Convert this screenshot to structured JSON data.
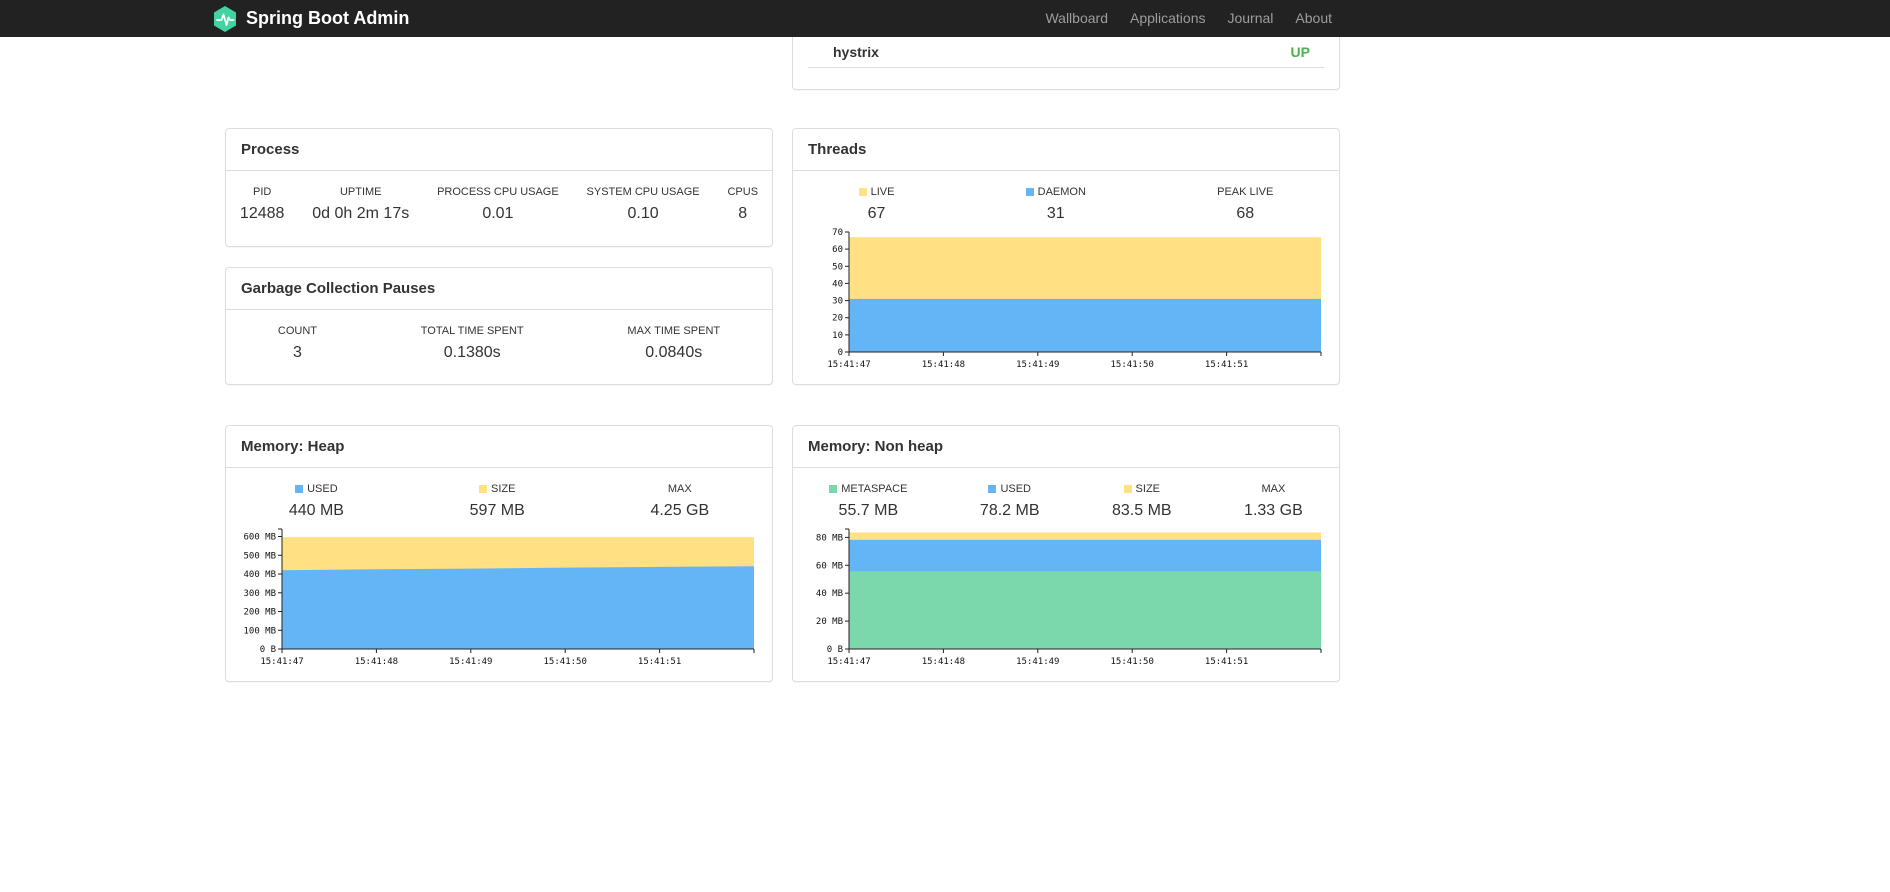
{
  "colors": {
    "brand_logo": "#42d3a2",
    "status_up": "#4caf50"
  },
  "navbar": {
    "brand": "Spring Boot Admin",
    "items": [
      "Wallboard",
      "Applications",
      "Journal",
      "About"
    ]
  },
  "application_panel": {
    "rows": [
      {
        "name": "hystrix",
        "status": "UP"
      }
    ]
  },
  "panels": {
    "process": {
      "title": "Process",
      "metrics": [
        {
          "label": "PID",
          "value": "12488"
        },
        {
          "label": "UPTIME",
          "value": "0d 0h 2m 17s"
        },
        {
          "label": "PROCESS CPU USAGE",
          "value": "0.01"
        },
        {
          "label": "SYSTEM CPU USAGE",
          "value": "0.10"
        },
        {
          "label": "CPUS",
          "value": "8"
        }
      ]
    },
    "gc": {
      "title": "Garbage Collection Pauses",
      "metrics": [
        {
          "label": "COUNT",
          "value": "3"
        },
        {
          "label": "TOTAL TIME SPENT",
          "value": "0.1380s"
        },
        {
          "label": "MAX TIME SPENT",
          "value": "0.0840s"
        }
      ]
    },
    "threads": {
      "title": "Threads",
      "metrics": [
        {
          "label": "LIVE",
          "value": "67",
          "swatch": "#ffe082"
        },
        {
          "label": "DAEMON",
          "value": "31",
          "swatch": "#64b5f6"
        },
        {
          "label": "PEAK LIVE",
          "value": "68"
        }
      ],
      "chart_data": {
        "type": "area",
        "title": "Threads",
        "x_labels": [
          "15:41:47",
          "15:41:48",
          "15:41:49",
          "15:41:50",
          "15:41:51"
        ],
        "ylim": [
          0,
          70
        ],
        "y_tick_values": [
          0,
          10,
          20,
          30,
          40,
          50,
          60,
          70
        ],
        "y_tick_labels": [
          "0",
          "10",
          "20",
          "30",
          "40",
          "50",
          "60",
          "70"
        ],
        "grid": false,
        "series": [
          {
            "name": "LIVE",
            "color": "#ffe082",
            "values": [
              67,
              67,
              67,
              67,
              67,
              67
            ]
          },
          {
            "name": "DAEMON",
            "color": "#64b5f6",
            "values": [
              31,
              31,
              31,
              31,
              31,
              31
            ]
          }
        ]
      }
    },
    "heap": {
      "title": "Memory: Heap",
      "metrics": [
        {
          "label": "USED",
          "value": "440 MB",
          "swatch": "#64b5f6"
        },
        {
          "label": "SIZE",
          "value": "597 MB",
          "swatch": "#ffe082"
        },
        {
          "label": "MAX",
          "value": "4.25 GB"
        }
      ],
      "chart_data": {
        "type": "area",
        "title": "Memory: Heap",
        "x_labels": [
          "15:41:47",
          "15:41:48",
          "15:41:49",
          "15:41:50",
          "15:41:51"
        ],
        "ylim": [
          0,
          640
        ],
        "y_tick_values": [
          0,
          100,
          200,
          300,
          400,
          500,
          600
        ],
        "y_tick_labels": [
          "0 B",
          "100 MB",
          "200 MB",
          "300 MB",
          "400 MB",
          "500 MB",
          "600 MB"
        ],
        "grid": false,
        "series": [
          {
            "name": "SIZE",
            "color": "#ffe082",
            "values": [
              597,
              597,
              597,
              597,
              597,
              597
            ]
          },
          {
            "name": "USED",
            "color": "#64b5f6",
            "values": [
              420,
              425,
              429,
              434,
              438,
              441
            ]
          }
        ]
      }
    },
    "nonheap": {
      "title": "Memory: Non heap",
      "metrics": [
        {
          "label": "METASPACE",
          "value": "55.7 MB",
          "swatch": "#7bd8ad"
        },
        {
          "label": "USED",
          "value": "78.2 MB",
          "swatch": "#64b5f6"
        },
        {
          "label": "SIZE",
          "value": "83.5 MB",
          "swatch": "#ffe082"
        },
        {
          "label": "MAX",
          "value": "1.33 GB"
        }
      ],
      "chart_data": {
        "type": "area",
        "title": "Memory: Non heap",
        "x_labels": [
          "15:41:47",
          "15:41:48",
          "15:41:49",
          "15:41:50",
          "15:41:51"
        ],
        "ylim": [
          0,
          86
        ],
        "y_tick_values": [
          0,
          20,
          40,
          60,
          80
        ],
        "y_tick_labels": [
          "0 B",
          "20 MB",
          "40 MB",
          "60 MB",
          "80 MB"
        ],
        "grid": false,
        "series": [
          {
            "name": "SIZE",
            "color": "#ffe082",
            "values": [
              83.5,
              83.5,
              83.5,
              83.5,
              83.5,
              83.5
            ]
          },
          {
            "name": "USED",
            "color": "#64b5f6",
            "values": [
              78.2,
              78.2,
              78.2,
              78.2,
              78.2,
              78.2
            ]
          },
          {
            "name": "METASPACE",
            "color": "#7bd8ad",
            "values": [
              55.7,
              55.7,
              55.7,
              55.7,
              55.7,
              55.7
            ]
          }
        ]
      }
    }
  }
}
